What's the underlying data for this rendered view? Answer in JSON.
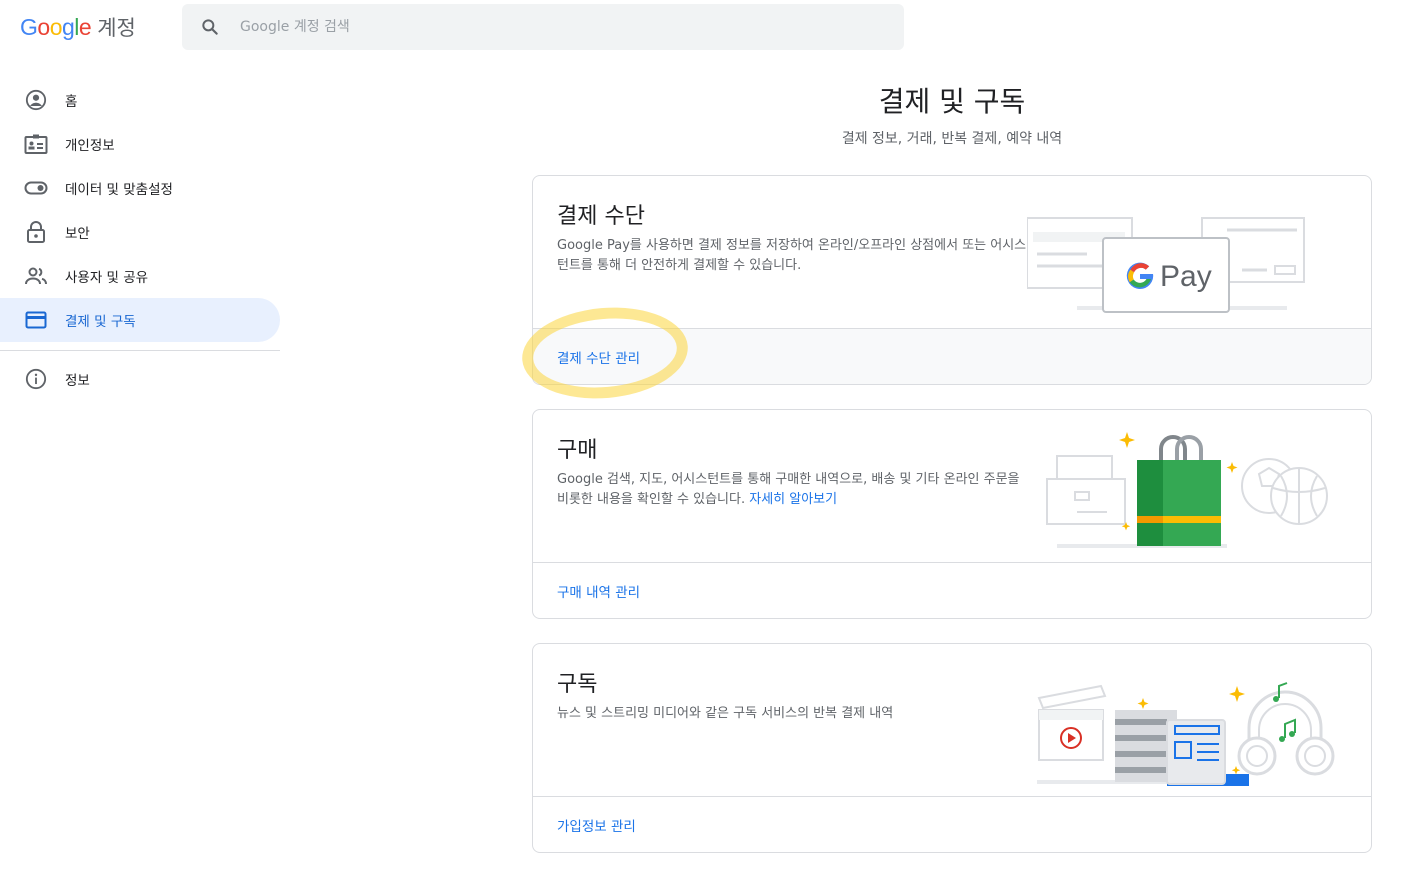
{
  "header": {
    "logo_word": "Google",
    "product": "계정",
    "search_placeholder": "Google 계정 검색"
  },
  "sidebar": {
    "items": [
      {
        "label": "홈",
        "icon": "account-circle-icon"
      },
      {
        "label": "개인정보",
        "icon": "id-card-icon"
      },
      {
        "label": "데이터 및 맞춤설정",
        "icon": "toggle-icon"
      },
      {
        "label": "보안",
        "icon": "lock-icon"
      },
      {
        "label": "사용자 및 공유",
        "icon": "people-icon"
      },
      {
        "label": "결제 및 구독",
        "icon": "credit-card-icon",
        "active": true
      }
    ],
    "secondary": [
      {
        "label": "정보",
        "icon": "info-icon"
      }
    ]
  },
  "main": {
    "title": "결제 및 구독",
    "subtitle": "결제 정보, 거래, 반복 결제, 예약 내역"
  },
  "cards": {
    "payment": {
      "title": "결제 수단",
      "desc": "Google Pay를 사용하면 결제 정보를 저장하여 온라인/오프라인 상점에서 또는 어시스턴트를 통해 더 안전하게 결제할 수 있습니다.",
      "gpay_label": "Pay",
      "link": "결제 수단 관리"
    },
    "purchases": {
      "title": "구매",
      "desc": "Google 검색, 지도, 어시스턴트를 통해 구매한 내역으로, 배송 및 기타 온라인 주문을 비롯한 내용을 확인할 수 있습니다.",
      "learn_more": "자세히 알아보기",
      "link": "구매 내역 관리"
    },
    "subscriptions": {
      "title": "구독",
      "desc": "뉴스 및 스트리밍 미디어와 같은 구독 서비스의 반복 결제 내역",
      "link": "가입정보 관리"
    }
  },
  "colors": {
    "accent": "#1a73e8",
    "active_bg": "#e8f0fe",
    "highlight": "#fbd63c"
  }
}
